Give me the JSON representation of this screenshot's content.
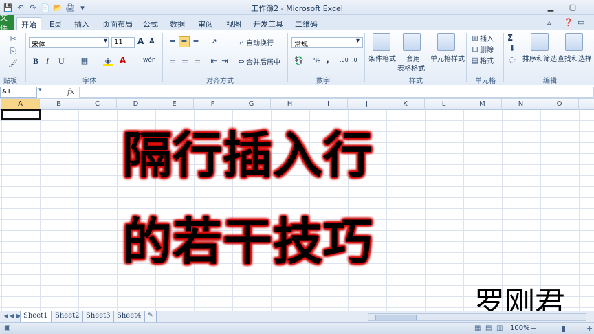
{
  "window": {
    "title": "工作簿2 - Microsoft Excel",
    "min": "▁",
    "max": "▢"
  },
  "qat": [
    "💾",
    "↶",
    "↷",
    "📄",
    "📂",
    "🖨",
    "▾"
  ],
  "tabs": {
    "file": "文件",
    "items": [
      "开始",
      "E灵",
      "插入",
      "页面布局",
      "公式",
      "数据",
      "审阅",
      "视图",
      "开发工具",
      "二维码"
    ],
    "active": "开始"
  },
  "ribbon": {
    "clipboard_label": "贴板",
    "font_name": "宋体",
    "font_size": "11",
    "font_label": "字体",
    "bold": "B",
    "italic": "I",
    "underline": "U",
    "grow": "A",
    "shrink": "A",
    "wen": "wén",
    "align_label": "对齐方式",
    "wrap_text": "自动换行",
    "merge_center": "合并后居中",
    "number_format": "常规",
    "number_label": "数字",
    "percent": "%",
    "comma": ",",
    "inc_dec": ".00",
    "cond_format": "条件格式",
    "table_format_1": "套用",
    "table_format_2": "表格格式",
    "cell_styles": "单元格样式",
    "styles_label": "样式",
    "insert": "插入",
    "delete": "删除",
    "format": "格式",
    "cells_label": "单元格",
    "sort_filter": "排序和筛选",
    "find_select": "查找和选择",
    "edit_label": "编辑",
    "sigma": "Σ"
  },
  "formula_bar": {
    "name_box": "A1",
    "fx": "fx",
    "formula": ""
  },
  "columns": [
    "A",
    "B",
    "C",
    "D",
    "E",
    "F",
    "G",
    "H",
    "I",
    "J",
    "K",
    "L",
    "M",
    "N",
    "O"
  ],
  "selected_column": "A",
  "overlay": {
    "line1": "隔行插入行",
    "line2": "的若干技巧",
    "author": "罗刚君"
  },
  "sheets": {
    "tabs": [
      "Sheet1",
      "Sheet2",
      "Sheet3",
      "Sheet4"
    ],
    "active": "Sheet1"
  },
  "statusbar": {
    "zoom": "100%",
    "zoom_percent": 100
  },
  "colors": {
    "file_tab": "#2a8a3a",
    "text_glow": "#d40000",
    "selected_col": "#f7d68a"
  }
}
